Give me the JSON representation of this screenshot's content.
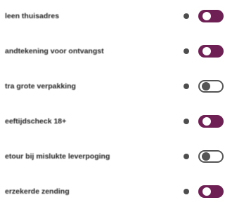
{
  "options": [
    {
      "label": "leen thuisadres",
      "enabled": true
    },
    {
      "label": "andtekening voor ontvangst",
      "enabled": true
    },
    {
      "label": "tra grote verpakking",
      "enabled": false
    },
    {
      "label": "eeftijdscheck 18+",
      "enabled": true
    },
    {
      "label": "etour bij mislukte leverpoging",
      "enabled": false
    },
    {
      "label": "erzekerde zending",
      "enabled": true
    }
  ],
  "icons": {
    "info": "info-icon"
  },
  "colors": {
    "toggle_on": "#6e1f53",
    "toggle_off_border": "#555555",
    "info_icon": "#4d4d4d"
  }
}
